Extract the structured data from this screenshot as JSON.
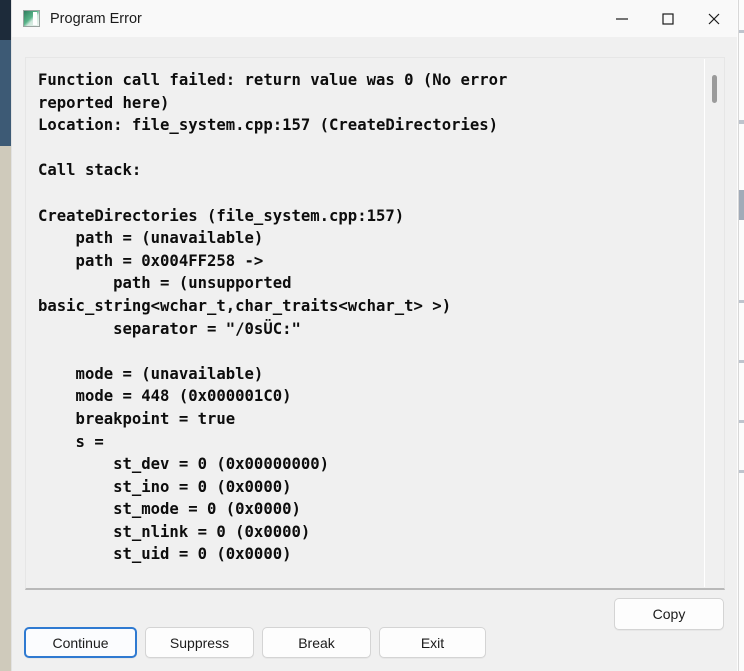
{
  "window": {
    "title": "Program Error",
    "icon": "program-icon",
    "controls": {
      "minimize": "minimize-icon",
      "maximize": "maximize-icon",
      "close": "close-icon"
    }
  },
  "error_text": {
    "lines": [
      "Function call failed: return value was 0 (No error",
      "reported here)",
      "Location: file_system.cpp:157 (CreateDirectories)",
      "",
      "Call stack:",
      "",
      "CreateDirectories (file_system.cpp:157)",
      "    path = (unavailable)",
      "    path = 0x004FF258 ->",
      "        path = (unsupported",
      "basic_string<wchar_t,char_traits<wchar_t> >)",
      "        separator = \"/0ѕÜC:\"",
      "",
      "    mode = (unavailable)",
      "    mode = 448 (0x000001C0)",
      "    breakpoint = true",
      "    s =",
      "        st_dev = 0 (0x00000000)",
      "        st_ino = 0 (0x0000)",
      "        st_mode = 0 (0x0000)",
      "        st_nlink = 0 (0x0000)",
      "        st_uid = 0 (0x0000)"
    ],
    "full_text": "Function call failed: return value was 0 (No error\nreported here)\nLocation: file_system.cpp:157 (CreateDirectories)\n\nCall stack:\n\nCreateDirectories (file_system.cpp:157)\n    path = (unavailable)\n    path = 0x004FF258 ->\n        path = (unsupported\nbasic_string<wchar_t,char_traits<wchar_t> >)\n        separator = \"/0ѕÜC:\"\n\n    mode = (unavailable)\n    mode = 448 (0x000001C0)\n    breakpoint = true\n    s =\n        st_dev = 0 (0x00000000)\n        st_ino = 0 (0x0000)\n        st_mode = 0 (0x0000)\n        st_nlink = 0 (0x0000)\n        st_uid = 0 (0x0000)"
  },
  "scrollbar": {
    "name": "vertical-scrollbar",
    "thumb_position_pct": 3
  },
  "copy": {
    "label": "Copy"
  },
  "buttons": [
    {
      "id": "continue",
      "label": "Continue",
      "focused": true
    },
    {
      "id": "suppress",
      "label": "Suppress",
      "focused": false
    },
    {
      "id": "break",
      "label": "Break",
      "focused": false
    },
    {
      "id": "exit",
      "label": "Exit",
      "focused": false
    }
  ],
  "colors": {
    "window_bg": "#f0f0f0",
    "titlebar_bg": "#f9f9f9",
    "text_fg": "#0d0d0d",
    "focus_border": "#2f7ad1",
    "close_hover": "#e81123",
    "bg_window_navy": "#1d2b3a",
    "bg_window_steel": "#3d5a75",
    "bg_window_tan": "#cfcabb"
  }
}
